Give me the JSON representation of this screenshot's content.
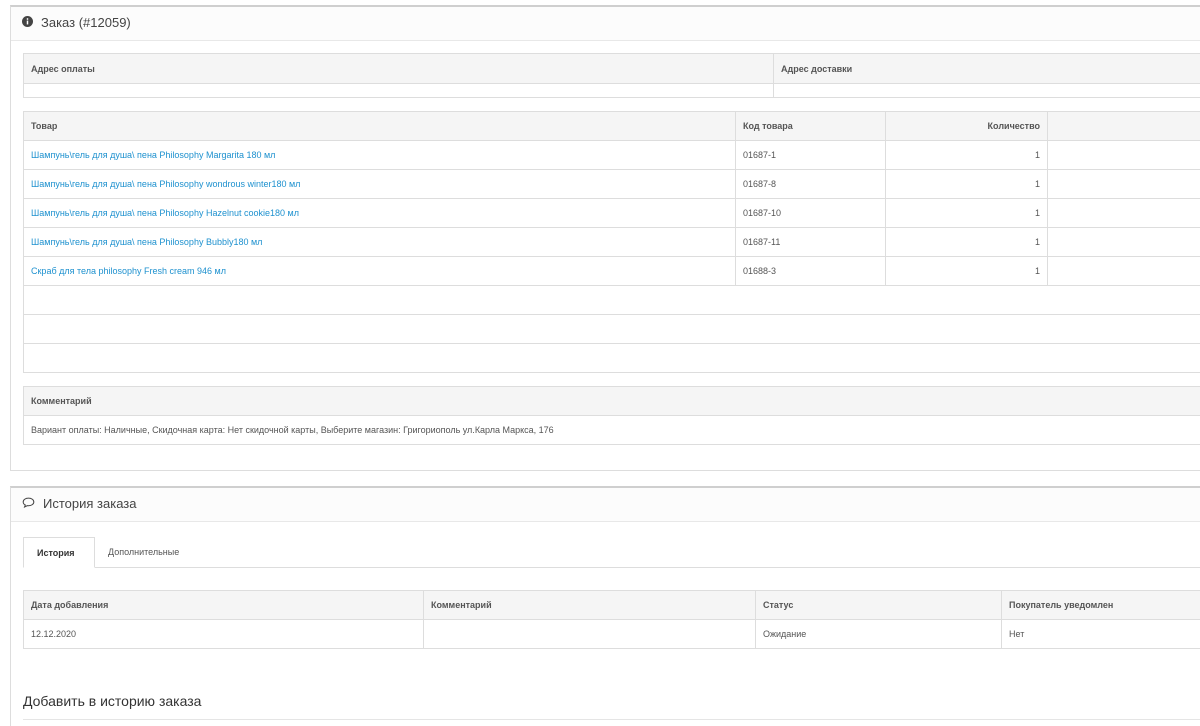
{
  "order_panel": {
    "title": "Заказ (#12059)",
    "address_headers": [
      "Адрес оплаты",
      "Адрес доставки"
    ],
    "products": {
      "headers": [
        "Товар",
        "Код товара",
        "Количество"
      ],
      "rows": [
        {
          "name": "Шампунь\\гель для душа\\ пена Philosophy Margarita 180 мл",
          "code": "01687-1",
          "qty": "1"
        },
        {
          "name": "Шампунь\\гель для душа\\ пена Philosophy wondrous winter180 мл",
          "code": "01687-8",
          "qty": "1"
        },
        {
          "name": "Шампунь\\гель для душа\\ пена Philosophy Hazelnut cookie180 мл",
          "code": "01687-10",
          "qty": "1"
        },
        {
          "name": "Шампунь\\гель для душа\\ пена Philosophy Bubbly180 мл",
          "code": "01687-11",
          "qty": "1"
        },
        {
          "name": "Скраб для тела philosophy Fresh cream 946 мл",
          "code": "01688-3",
          "qty": "1"
        }
      ]
    },
    "comment": {
      "header": "Комментарий",
      "text": "Вариант оплаты: Наличные, Скидочная карта: Нет скидочной карты, Выберите магазин: Григориополь ул.Карла Маркса, 176"
    }
  },
  "history_panel": {
    "title": "История заказа",
    "tabs": [
      "История",
      "Дополнительные"
    ],
    "headers": [
      "Дата добавления",
      "Комментарий",
      "Статус",
      "Покупатель уведомлен"
    ],
    "rows": [
      {
        "date": "12.12.2020",
        "comment": "",
        "status": "Ожидание",
        "notified": "Нет"
      }
    ],
    "add_title": "Добавить в историю заказа"
  },
  "icons": {
    "order": "info-circle-icon",
    "history": "comment-bubble-icon"
  },
  "colors": {
    "link": "#1e91cf",
    "border": "#dddddd",
    "header_bg": "#f5f5f5"
  }
}
